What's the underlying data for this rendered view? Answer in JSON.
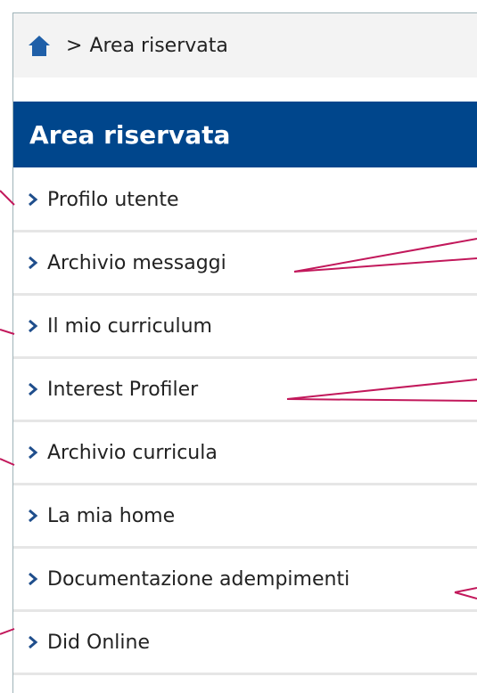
{
  "breadcrumb": {
    "home_icon": "home-icon",
    "separator": ">",
    "current": "Area riservata"
  },
  "panel": {
    "title": "Area riservata"
  },
  "menu": {
    "chevron_icon": "chevron-right-icon",
    "items": [
      {
        "label": "Profilo utente"
      },
      {
        "label": "Archivio messaggi"
      },
      {
        "label": "Il mio curriculum"
      },
      {
        "label": "Interest Profiler"
      },
      {
        "label": "Archivio curricula"
      },
      {
        "label": "La mia home"
      },
      {
        "label": "Documentazione adempimenti"
      },
      {
        "label": "Did Online"
      }
    ]
  },
  "colors": {
    "header_bg": "#00468c",
    "header_text": "#ffffff",
    "chevron": "#1f4e8c",
    "annotation_line": "#c2185b"
  }
}
